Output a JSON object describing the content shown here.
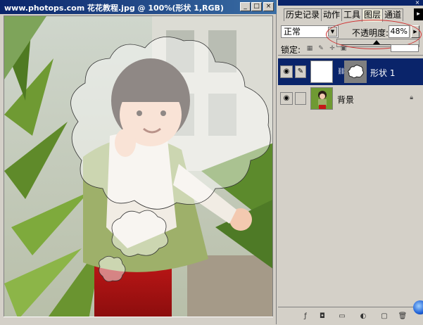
{
  "document": {
    "title": "www.photops.com 花花教程.jpg @ 100%(形状 1,RGB)",
    "buttons": {
      "minimize": "_",
      "maximize": "□",
      "close": "×"
    }
  },
  "panel": {
    "tabs": [
      {
        "label": "历史记录",
        "active": false
      },
      {
        "label": "动作",
        "active": false
      },
      {
        "label": "工具",
        "active": false
      },
      {
        "label": "图层",
        "active": true
      },
      {
        "label": "通道",
        "active": false
      }
    ],
    "menu_icon": "▸",
    "blend_mode": "正常",
    "opacity_label": "不透明度:",
    "opacity_value": "48%",
    "opacity_fraction": 0.48,
    "lock_label": "锁定:",
    "layers": [
      {
        "name": "形状 1",
        "selected": true,
        "has_mask": true
      },
      {
        "name": "背景",
        "selected": false,
        "locked": true
      }
    ]
  },
  "colors": {
    "titlebar": "#0a246a",
    "selection": "#0a246a",
    "panel_bg": "#d4d0c8",
    "highlight_ring": "#d03030"
  }
}
